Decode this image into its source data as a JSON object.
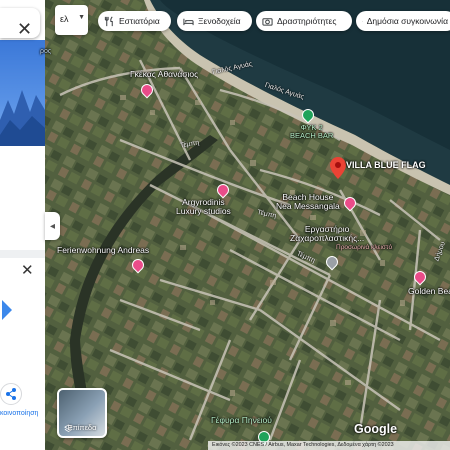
{
  "top_bar": {
    "language": "ελ",
    "chips": [
      {
        "label": "Εστιατόρια",
        "icon": "fork-knife-icon"
      },
      {
        "label": "Ξενοδοχεία",
        "icon": "bed-icon"
      },
      {
        "label": "Δραστηριότητες",
        "icon": "camera-icon"
      },
      {
        "label": "Δημόσια συγκοινωνία",
        "icon": "bus-icon"
      }
    ]
  },
  "side_panel": {
    "share_label": "κοινοποίηση"
  },
  "map": {
    "places": [
      {
        "label": "Γκέκας Αθανάσιος",
        "pin": "pink"
      },
      {
        "label": "ΦΥΚ 2\nBEACH BAR",
        "pin": "green"
      },
      {
        "label": "VILLA BLUE FLAG",
        "pin": "red"
      },
      {
        "label": "Beach House\nNea Messangala",
        "pin": "pink"
      },
      {
        "label": "Argyrodinis\nLuxury studios",
        "pin": "pink"
      },
      {
        "label": "Εργαστήριο\nΖαχαροπλαστικής...",
        "pin": "grey"
      },
      {
        "label": "Προσωρινά κλειστό",
        "pin": ""
      },
      {
        "label": "Ferienwohnung Andreas",
        "pin": "pink"
      },
      {
        "label": "Golden Beach",
        "pin": "pink"
      },
      {
        "label": "Γέφυρα Πηνειού",
        "pin": "green"
      }
    ],
    "roads": [
      "Γιαλός Αγυάς",
      "Γιαλός Αγυάς",
      "Τέμπη",
      "Τέμπη",
      "Τέμπη",
      "Δήμου"
    ],
    "water_label": "ρος"
  },
  "layers_button": {
    "label": "Επίπεδα"
  },
  "google_logo": "Google",
  "attribution": "Εικόνες ©2023 CNES / Airbus, Maxar Technologies, Δεδομένα χάρτη ©2023"
}
